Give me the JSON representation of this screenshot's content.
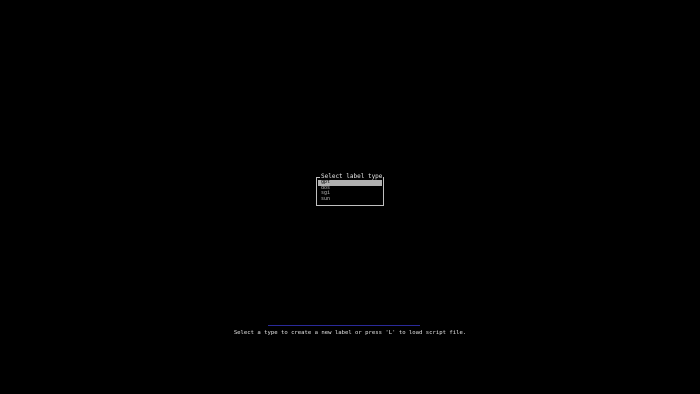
{
  "dialog": {
    "title": "Select label type",
    "options": [
      {
        "label": "gpt",
        "selected": true
      },
      {
        "label": "dos",
        "selected": false
      },
      {
        "label": "sgi",
        "selected": false
      },
      {
        "label": "sun",
        "selected": false
      }
    ]
  },
  "footer": {
    "help_text": "Select a type to create a new label or press 'L' to load script file."
  },
  "colors": {
    "background": "#000000",
    "dialog_border": "#bfbfbf",
    "selected_highlight": "#b0b0b0",
    "text": "#e4e4e4",
    "link_line": "#2a2a9a"
  }
}
